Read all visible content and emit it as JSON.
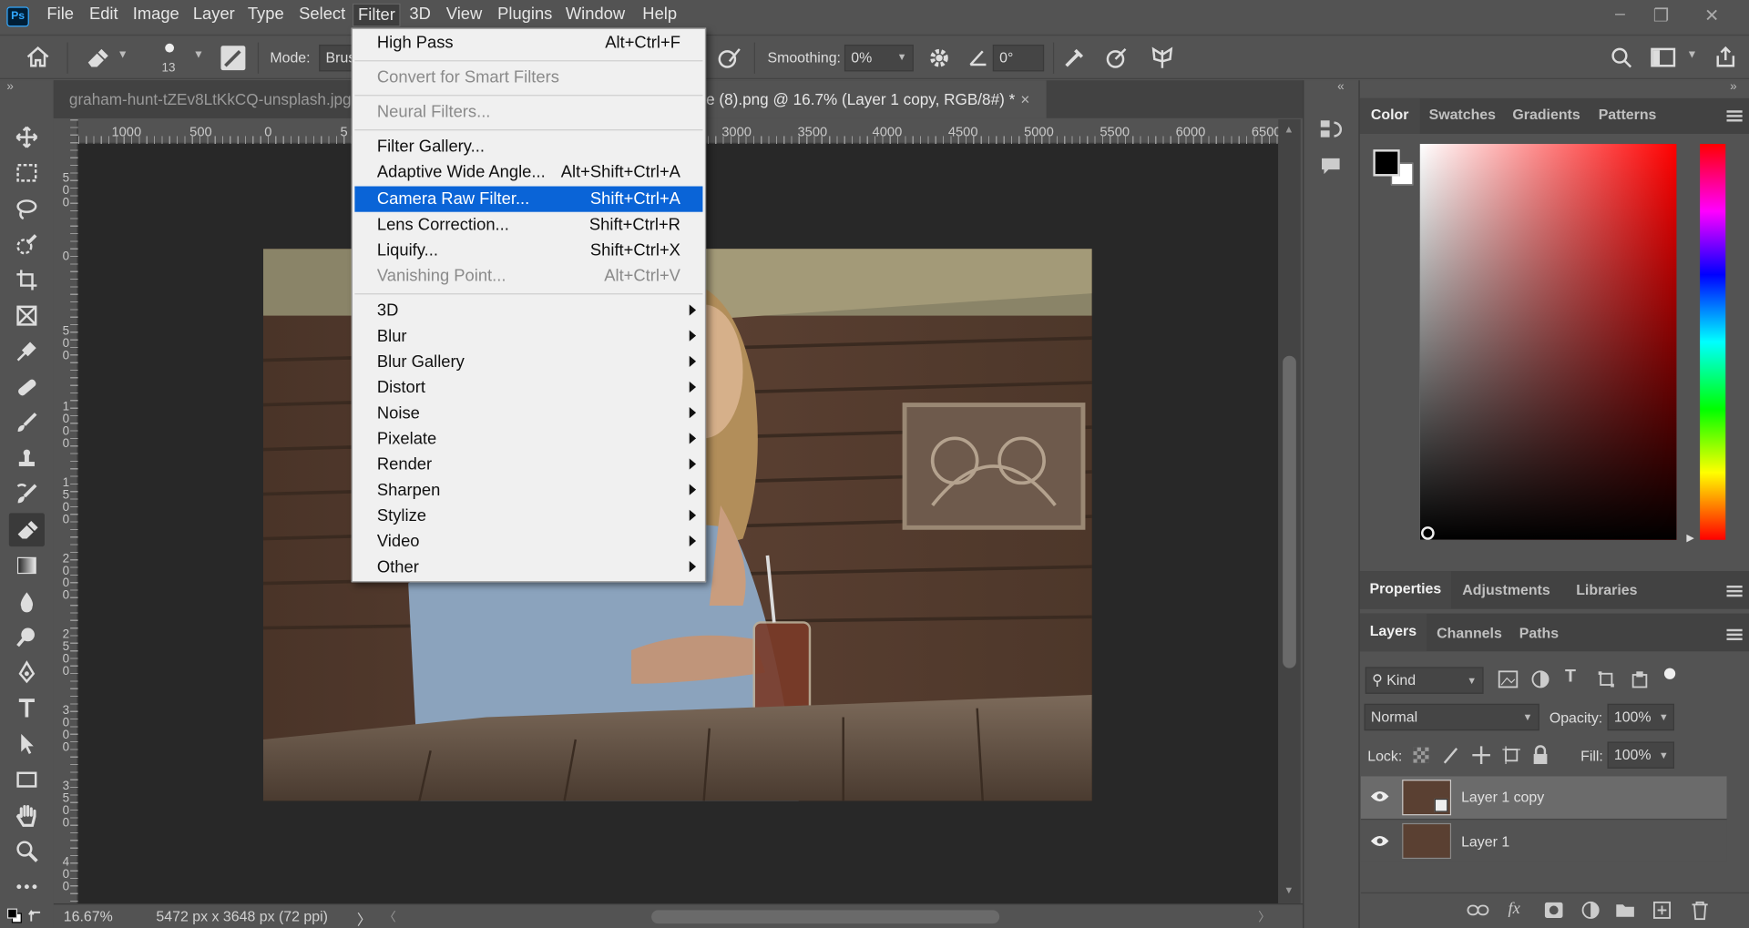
{
  "app": {
    "logo": "Ps"
  },
  "menubar": {
    "items": [
      "File",
      "Edit",
      "Image",
      "Layer",
      "Type",
      "Select",
      "Filter",
      "3D",
      "View",
      "Plugins",
      "Window",
      "Help"
    ]
  },
  "window_controls": {
    "minimize": "–",
    "restore": "❐",
    "close": "✕"
  },
  "options": {
    "brush_size": "13",
    "mode_label": "Mode:",
    "mode_value": "Brus",
    "smoothing_label": "Smoothing:",
    "smoothing_value": "0%",
    "angle_value": "0°"
  },
  "tabs": [
    {
      "label": "graham-hunt-tZEv8LtKkCQ-unsplash.jpg"
    },
    {
      "label": "e (8).png @ 16.7% (Layer 1 copy, RGB/8#) *",
      "close": "×"
    }
  ],
  "ruler_top": [
    "1000",
    "500",
    "0",
    "5",
    "3000",
    "3500",
    "4000",
    "4500",
    "5000",
    "5500",
    "6000",
    "6500"
  ],
  "ruler_left": [
    "5\n0\n0",
    "0",
    "5\n0\n0",
    "1\n0\n0\n0",
    "1\n5\n0\n0",
    "2\n0\n0\n0",
    "2\n5\n0\n0",
    "3\n0\n0\n0",
    "3\n5\n0\n0",
    "4\n0\n0"
  ],
  "status": {
    "zoom": "16.67%",
    "dimensions": "5472 px x 3648 px (72 ppi)",
    "arrow": "〉"
  },
  "filter_menu": {
    "items": [
      {
        "label": "High Pass",
        "shortcut": "Alt+Ctrl+F",
        "state": "normal"
      },
      {
        "sep": true
      },
      {
        "label": "Convert for Smart Filters",
        "shortcut": "",
        "state": "disabled"
      },
      {
        "sep": true
      },
      {
        "label": "Neural Filters...",
        "shortcut": "",
        "state": "disabled"
      },
      {
        "sep": true
      },
      {
        "label": "Filter Gallery...",
        "shortcut": "",
        "state": "normal"
      },
      {
        "label": "Adaptive Wide Angle...",
        "shortcut": "Alt+Shift+Ctrl+A",
        "state": "normal"
      },
      {
        "label": "Camera Raw Filter...",
        "shortcut": "Shift+Ctrl+A",
        "state": "highlighted"
      },
      {
        "label": "Lens Correction...",
        "shortcut": "Shift+Ctrl+R",
        "state": "normal"
      },
      {
        "label": "Liquify...",
        "shortcut": "Shift+Ctrl+X",
        "state": "normal"
      },
      {
        "label": "Vanishing Point...",
        "shortcut": "Alt+Ctrl+V",
        "state": "disabled"
      },
      {
        "sep": true
      },
      {
        "label": "3D",
        "submenu": true
      },
      {
        "label": "Blur",
        "submenu": true
      },
      {
        "label": "Blur Gallery",
        "submenu": true
      },
      {
        "label": "Distort",
        "submenu": true
      },
      {
        "label": "Noise",
        "submenu": true
      },
      {
        "label": "Pixelate",
        "submenu": true
      },
      {
        "label": "Render",
        "submenu": true
      },
      {
        "label": "Sharpen",
        "submenu": true
      },
      {
        "label": "Stylize",
        "submenu": true
      },
      {
        "label": "Video",
        "submenu": true
      },
      {
        "label": "Other",
        "submenu": true
      }
    ]
  },
  "color_panel": {
    "tabs": [
      "Color",
      "Swatches",
      "Gradients",
      "Patterns"
    ],
    "active": "Color",
    "foreground": "#000000",
    "background": "#ffffff",
    "hue": "#ff0000"
  },
  "properties_panel": {
    "tabs": [
      "Properties",
      "Adjustments",
      "Libraries"
    ],
    "active": "Properties"
  },
  "layers_panel": {
    "tabs": [
      "Layers",
      "Channels",
      "Paths"
    ],
    "active": "Layers",
    "kind_filter": "Kind",
    "blend_mode": "Normal",
    "opacity_label": "Opacity:",
    "opacity": "100%",
    "lock_label": "Lock:",
    "fill_label": "Fill:",
    "fill": "100%",
    "layers": [
      {
        "name": "Layer 1 copy",
        "selected": true
      },
      {
        "name": "Layer 1",
        "selected": false
      }
    ],
    "footer_fx": "fx"
  }
}
